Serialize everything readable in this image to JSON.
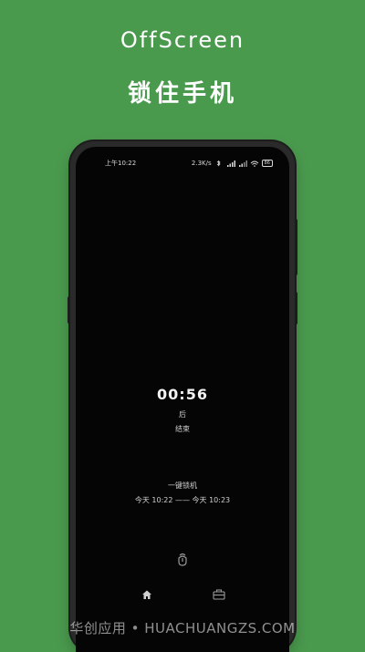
{
  "headline": {
    "title": "OffScreen",
    "subtitle": "锁住手机"
  },
  "status_bar": {
    "time": "上午10:22",
    "speed": "2.3K/s",
    "battery": "86"
  },
  "timer": {
    "countdown": "00:56",
    "after_label": "后",
    "end_label": "结束"
  },
  "lock": {
    "title": "一键锁机",
    "range": "今天 10:22 —— 今天 10:23"
  },
  "icons": {
    "unlock": "fingerprint-icon",
    "home": "home-icon",
    "box": "toolbox-icon"
  },
  "watermark": "华创应用 • HUACHUANGZS.COM"
}
